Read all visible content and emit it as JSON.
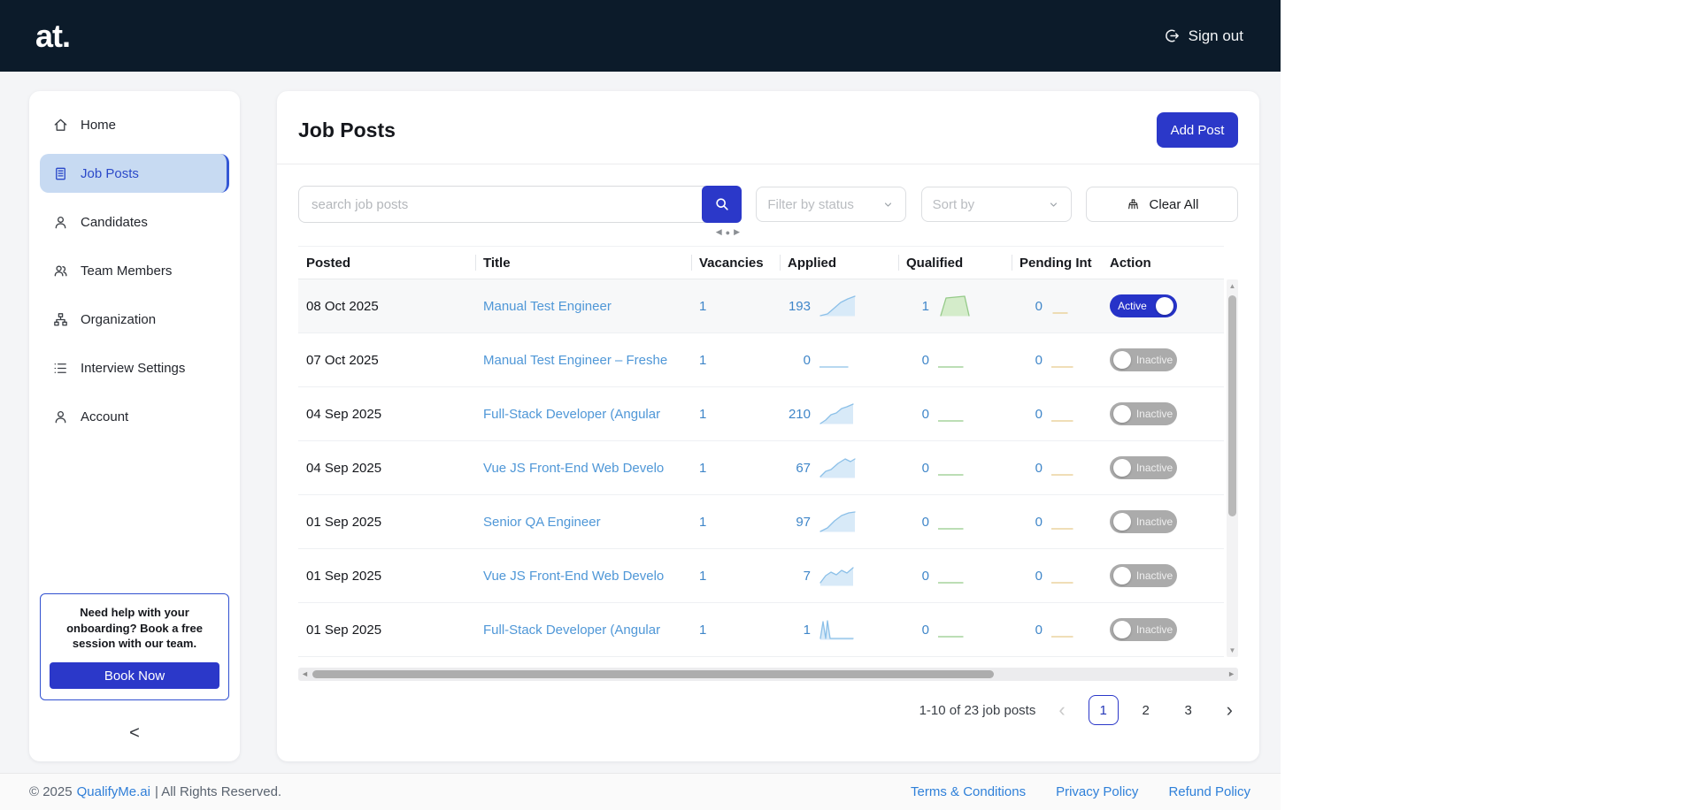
{
  "topbar": {
    "logo": "at.",
    "signout": "Sign out"
  },
  "sidebar": {
    "items": [
      {
        "label": "Home",
        "icon": "home",
        "active": false
      },
      {
        "label": "Job Posts",
        "icon": "job-posts",
        "active": true
      },
      {
        "label": "Candidates",
        "icon": "person",
        "active": false
      },
      {
        "label": "Team Members",
        "icon": "people",
        "active": false
      },
      {
        "label": "Organization",
        "icon": "org-chart",
        "active": false
      },
      {
        "label": "Interview Settings",
        "icon": "list",
        "active": false
      },
      {
        "label": "Account",
        "icon": "person",
        "active": false
      }
    ],
    "help_text": "Need help with your onboarding? Book a free session with our team.",
    "book_button": "Book Now",
    "collapse_icon": "<"
  },
  "main": {
    "title": "Job Posts",
    "add_post_button": "Add Post",
    "search_placeholder": "search job posts",
    "filter_status_label": "Filter by status",
    "sort_label": "Sort by",
    "clear_all_label": "Clear All",
    "table": {
      "headers": [
        "Posted",
        "Title",
        "Vacancies",
        "Applied",
        "Qualified",
        "Pending Int",
        "Action"
      ],
      "rows": [
        {
          "posted": "08 Oct 2025",
          "title": "Manual Test Engineer",
          "vacancies": "1",
          "applied": "193",
          "qualified": "1",
          "pending": "0",
          "status": "Active",
          "active": true,
          "applied_spark": {
            "type": "area",
            "color": "blue",
            "points": [
              [
                1,
                23
              ],
              [
                9,
                21
              ],
              [
                16,
                15
              ],
              [
                24,
                8
              ],
              [
                32,
                4
              ],
              [
                40,
                1
              ]
            ]
          },
          "qualified_spark": {
            "type": "area",
            "color": "green",
            "points": [
              [
                3,
                23
              ],
              [
                9,
                3
              ],
              [
                30,
                1
              ],
              [
                35,
                23
              ]
            ]
          },
          "pending_spark": {
            "type": "line",
            "color": "yellow",
            "points": [
              [
                2,
                20
              ],
              [
                18,
                20
              ]
            ]
          }
        },
        {
          "posted": "07 Oct 2025",
          "title": "Manual Test Engineer – Freshe",
          "vacancies": "1",
          "applied": "0",
          "qualified": "0",
          "pending": "0",
          "status": "Inactive",
          "active": false,
          "applied_spark": {
            "type": "line",
            "color": "blue",
            "points": [
              [
                0,
                20
              ],
              [
                32,
                20
              ]
            ]
          },
          "qualified_spark": {
            "type": "line",
            "color": "green",
            "points": [
              [
                0,
                20
              ],
              [
                28,
                20
              ]
            ]
          },
          "pending_spark": {
            "type": "line",
            "color": "yellow",
            "points": [
              [
                0,
                20
              ],
              [
                24,
                20
              ]
            ]
          }
        },
        {
          "posted": "04 Sep 2025",
          "title": "Full-Stack Developer (Angular",
          "vacancies": "1",
          "applied": "210",
          "qualified": "0",
          "pending": "0",
          "status": "Inactive",
          "active": false,
          "applied_spark": {
            "type": "area",
            "color": "blue",
            "points": [
              [
                1,
                23
              ],
              [
                7,
                19
              ],
              [
                13,
                13
              ],
              [
                19,
                11
              ],
              [
                25,
                6
              ],
              [
                31,
                4
              ],
              [
                38,
                1
              ]
            ]
          },
          "qualified_spark": {
            "type": "line",
            "color": "green",
            "points": [
              [
                0,
                20
              ],
              [
                28,
                20
              ]
            ]
          },
          "pending_spark": {
            "type": "line",
            "color": "yellow",
            "points": [
              [
                0,
                20
              ],
              [
                24,
                20
              ]
            ]
          }
        },
        {
          "posted": "04 Sep 2025",
          "title": "Vue JS Front-End Web Develo",
          "vacancies": "1",
          "applied": "67",
          "qualified": "0",
          "pending": "0",
          "status": "Inactive",
          "active": false,
          "applied_spark": {
            "type": "area",
            "color": "blue",
            "points": [
              [
                1,
                22
              ],
              [
                7,
                16
              ],
              [
                13,
                14
              ],
              [
                21,
                7
              ],
              [
                29,
                2
              ],
              [
                35,
                5
              ],
              [
                40,
                2
              ]
            ]
          },
          "qualified_spark": {
            "type": "line",
            "color": "green",
            "points": [
              [
                0,
                20
              ],
              [
                28,
                20
              ]
            ]
          },
          "pending_spark": {
            "type": "line",
            "color": "yellow",
            "points": [
              [
                0,
                20
              ],
              [
                24,
                20
              ]
            ]
          }
        },
        {
          "posted": "01 Sep 2025",
          "title": "Senior QA Engineer",
          "vacancies": "1",
          "applied": "97",
          "qualified": "0",
          "pending": "0",
          "status": "Inactive",
          "active": false,
          "applied_spark": {
            "type": "area",
            "color": "blue",
            "points": [
              [
                1,
                23
              ],
              [
                9,
                19
              ],
              [
                17,
                11
              ],
              [
                25,
                5
              ],
              [
                33,
                2
              ],
              [
                40,
                1
              ]
            ]
          },
          "qualified_spark": {
            "type": "line",
            "color": "green",
            "points": [
              [
                0,
                20
              ],
              [
                28,
                20
              ]
            ]
          },
          "pending_spark": {
            "type": "line",
            "color": "yellow",
            "points": [
              [
                0,
                20
              ],
              [
                24,
                20
              ]
            ]
          }
        },
        {
          "posted": "01 Sep 2025",
          "title": "Vue JS Front-End Web Develo",
          "vacancies": "1",
          "applied": "7",
          "qualified": "0",
          "pending": "0",
          "status": "Inactive",
          "active": false,
          "applied_spark": {
            "type": "area",
            "color": "blue",
            "points": [
              [
                1,
                20
              ],
              [
                7,
                12
              ],
              [
                13,
                8
              ],
              [
                19,
                11
              ],
              [
                25,
                6
              ],
              [
                31,
                9
              ],
              [
                38,
                3
              ]
            ]
          },
          "qualified_spark": {
            "type": "line",
            "color": "green",
            "points": [
              [
                0,
                20
              ],
              [
                28,
                20
              ]
            ]
          },
          "pending_spark": {
            "type": "line",
            "color": "yellow",
            "points": [
              [
                0,
                20
              ],
              [
                24,
                20
              ]
            ]
          }
        },
        {
          "posted": "01 Sep 2025",
          "title": "Full-Stack Developer (Angular",
          "vacancies": "1",
          "applied": "1",
          "qualified": "0",
          "pending": "0",
          "status": "Inactive",
          "active": false,
          "applied_spark": {
            "type": "area",
            "color": "blue",
            "points": [
              [
                1,
                22
              ],
              [
                4,
                3
              ],
              [
                7,
                22
              ],
              [
                9,
                2
              ],
              [
                12,
                22
              ],
              [
                38,
                22
              ]
            ]
          },
          "qualified_spark": {
            "type": "line",
            "color": "green",
            "points": [
              [
                0,
                20
              ],
              [
                28,
                20
              ]
            ]
          },
          "pending_spark": {
            "type": "line",
            "color": "yellow",
            "points": [
              [
                0,
                20
              ],
              [
                24,
                20
              ]
            ]
          }
        }
      ]
    },
    "pagination": {
      "summary": "1-10 of 23 job posts",
      "prev": "‹",
      "pages": [
        "1",
        "2",
        "3"
      ],
      "current": "1",
      "next": "›"
    }
  },
  "icons": {
    "carousel_prev": "◀",
    "carousel_dot": "●",
    "carousel_next": "▶",
    "scroll_up": "▲",
    "scroll_down": "▼",
    "scroll_left": "◄",
    "scroll_right": "►"
  },
  "footer": {
    "copyright_prefix": "© 2025",
    "brand": "QualifyMe.ai",
    "copyright_suffix": "| All Rights Reserved.",
    "links": [
      "Terms & Conditions",
      "Privacy Policy",
      "Refund Policy"
    ]
  },
  "colors": {
    "primary_blue": "#2b38c9",
    "topbar_navy": "#0c1b2a",
    "active_nav_bg": "#c7daf2",
    "link_blue": "#4f97d7",
    "number_blue": "#3f86c9",
    "footer_link_blue": "#2f80d9",
    "spark_blue_fill": "#d8eaf8",
    "spark_green_fill": "#d4ecca",
    "spark_yellow": "#e7cb8c"
  }
}
